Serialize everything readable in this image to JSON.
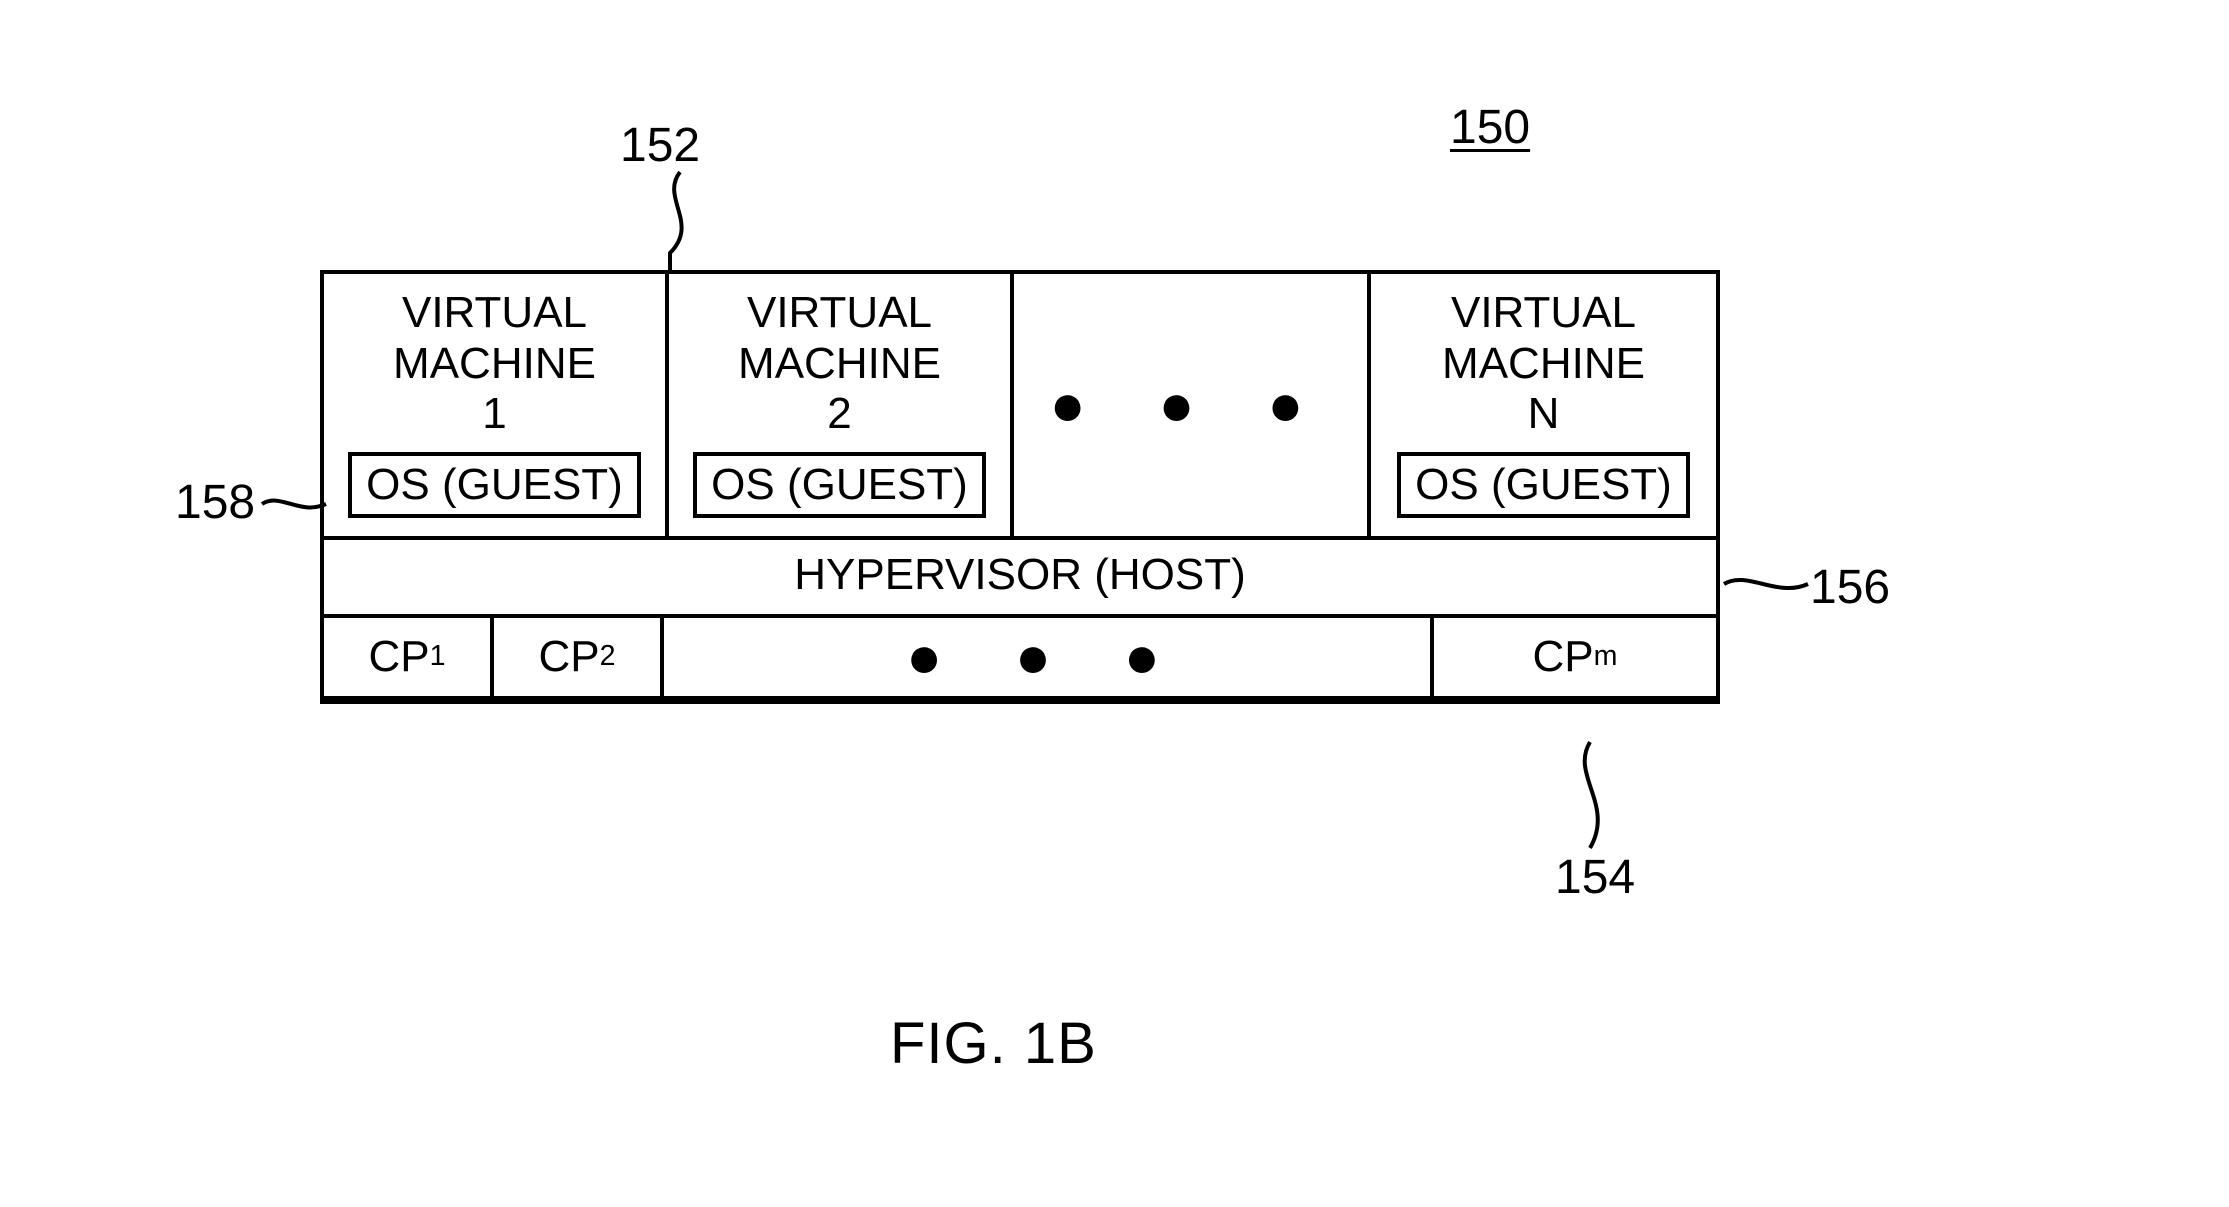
{
  "figure_ref": "150",
  "ref_vm_row": "152",
  "ref_os_guest": "158",
  "ref_hypervisor": "156",
  "ref_cp_row": "154",
  "caption": "FIG. 1B",
  "vm": {
    "cells": [
      {
        "title_l1": "VIRTUAL",
        "title_l2": "MACHINE",
        "index": "1",
        "os": "OS (GUEST)"
      },
      {
        "title_l1": "VIRTUAL",
        "title_l2": "MACHINE",
        "index": "2",
        "os": "OS (GUEST)"
      },
      {
        "title_l1": "VIRTUAL",
        "title_l2": "MACHINE",
        "index": "N",
        "os": "OS (GUEST)"
      }
    ],
    "ellipsis": "●   ●   ●"
  },
  "hypervisor": "HYPERVISOR (HOST)",
  "cp": {
    "items": [
      {
        "base": "CP",
        "sub": "1"
      },
      {
        "base": "CP",
        "sub": "2"
      },
      {
        "base": "CP",
        "sub": "m"
      }
    ],
    "ellipsis": "●   ●   ●"
  }
}
